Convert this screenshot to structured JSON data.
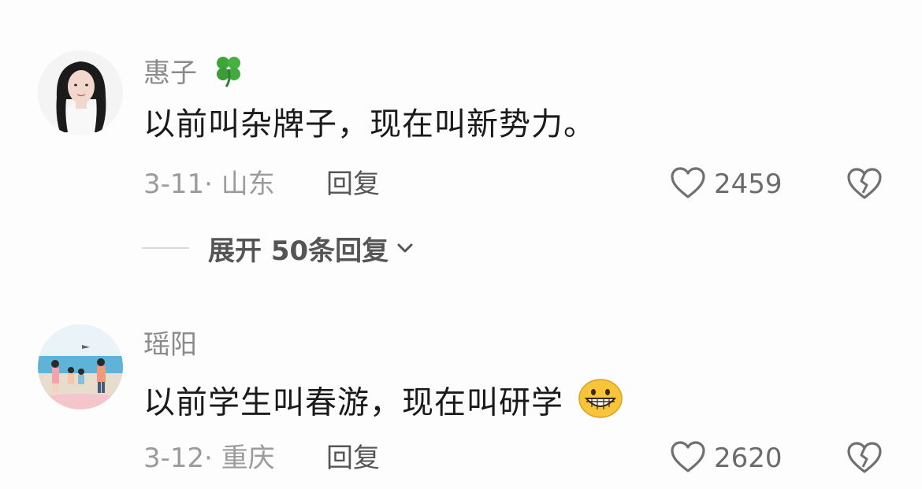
{
  "comments": [
    {
      "username": "惠子",
      "username_badge": "four-leaf-clover-icon",
      "content": "以前叫杂牌子，现在叫新势力。",
      "date_location": "3-11· 山东",
      "reply_label": "回复",
      "likes": "2459",
      "expand_replies_label": "展开 50条回复"
    },
    {
      "username": "瑶阳",
      "content": "以前学生叫春游，现在叫研学",
      "content_emoji": "grinning-face-icon",
      "date_location": "3-12· 重庆",
      "reply_label": "回复",
      "likes": "2620"
    }
  ],
  "colors": {
    "background": "#fdfdfd",
    "username": "#8a8a8a",
    "content": "#1a1a1a",
    "meta": "#9b9b9b"
  }
}
